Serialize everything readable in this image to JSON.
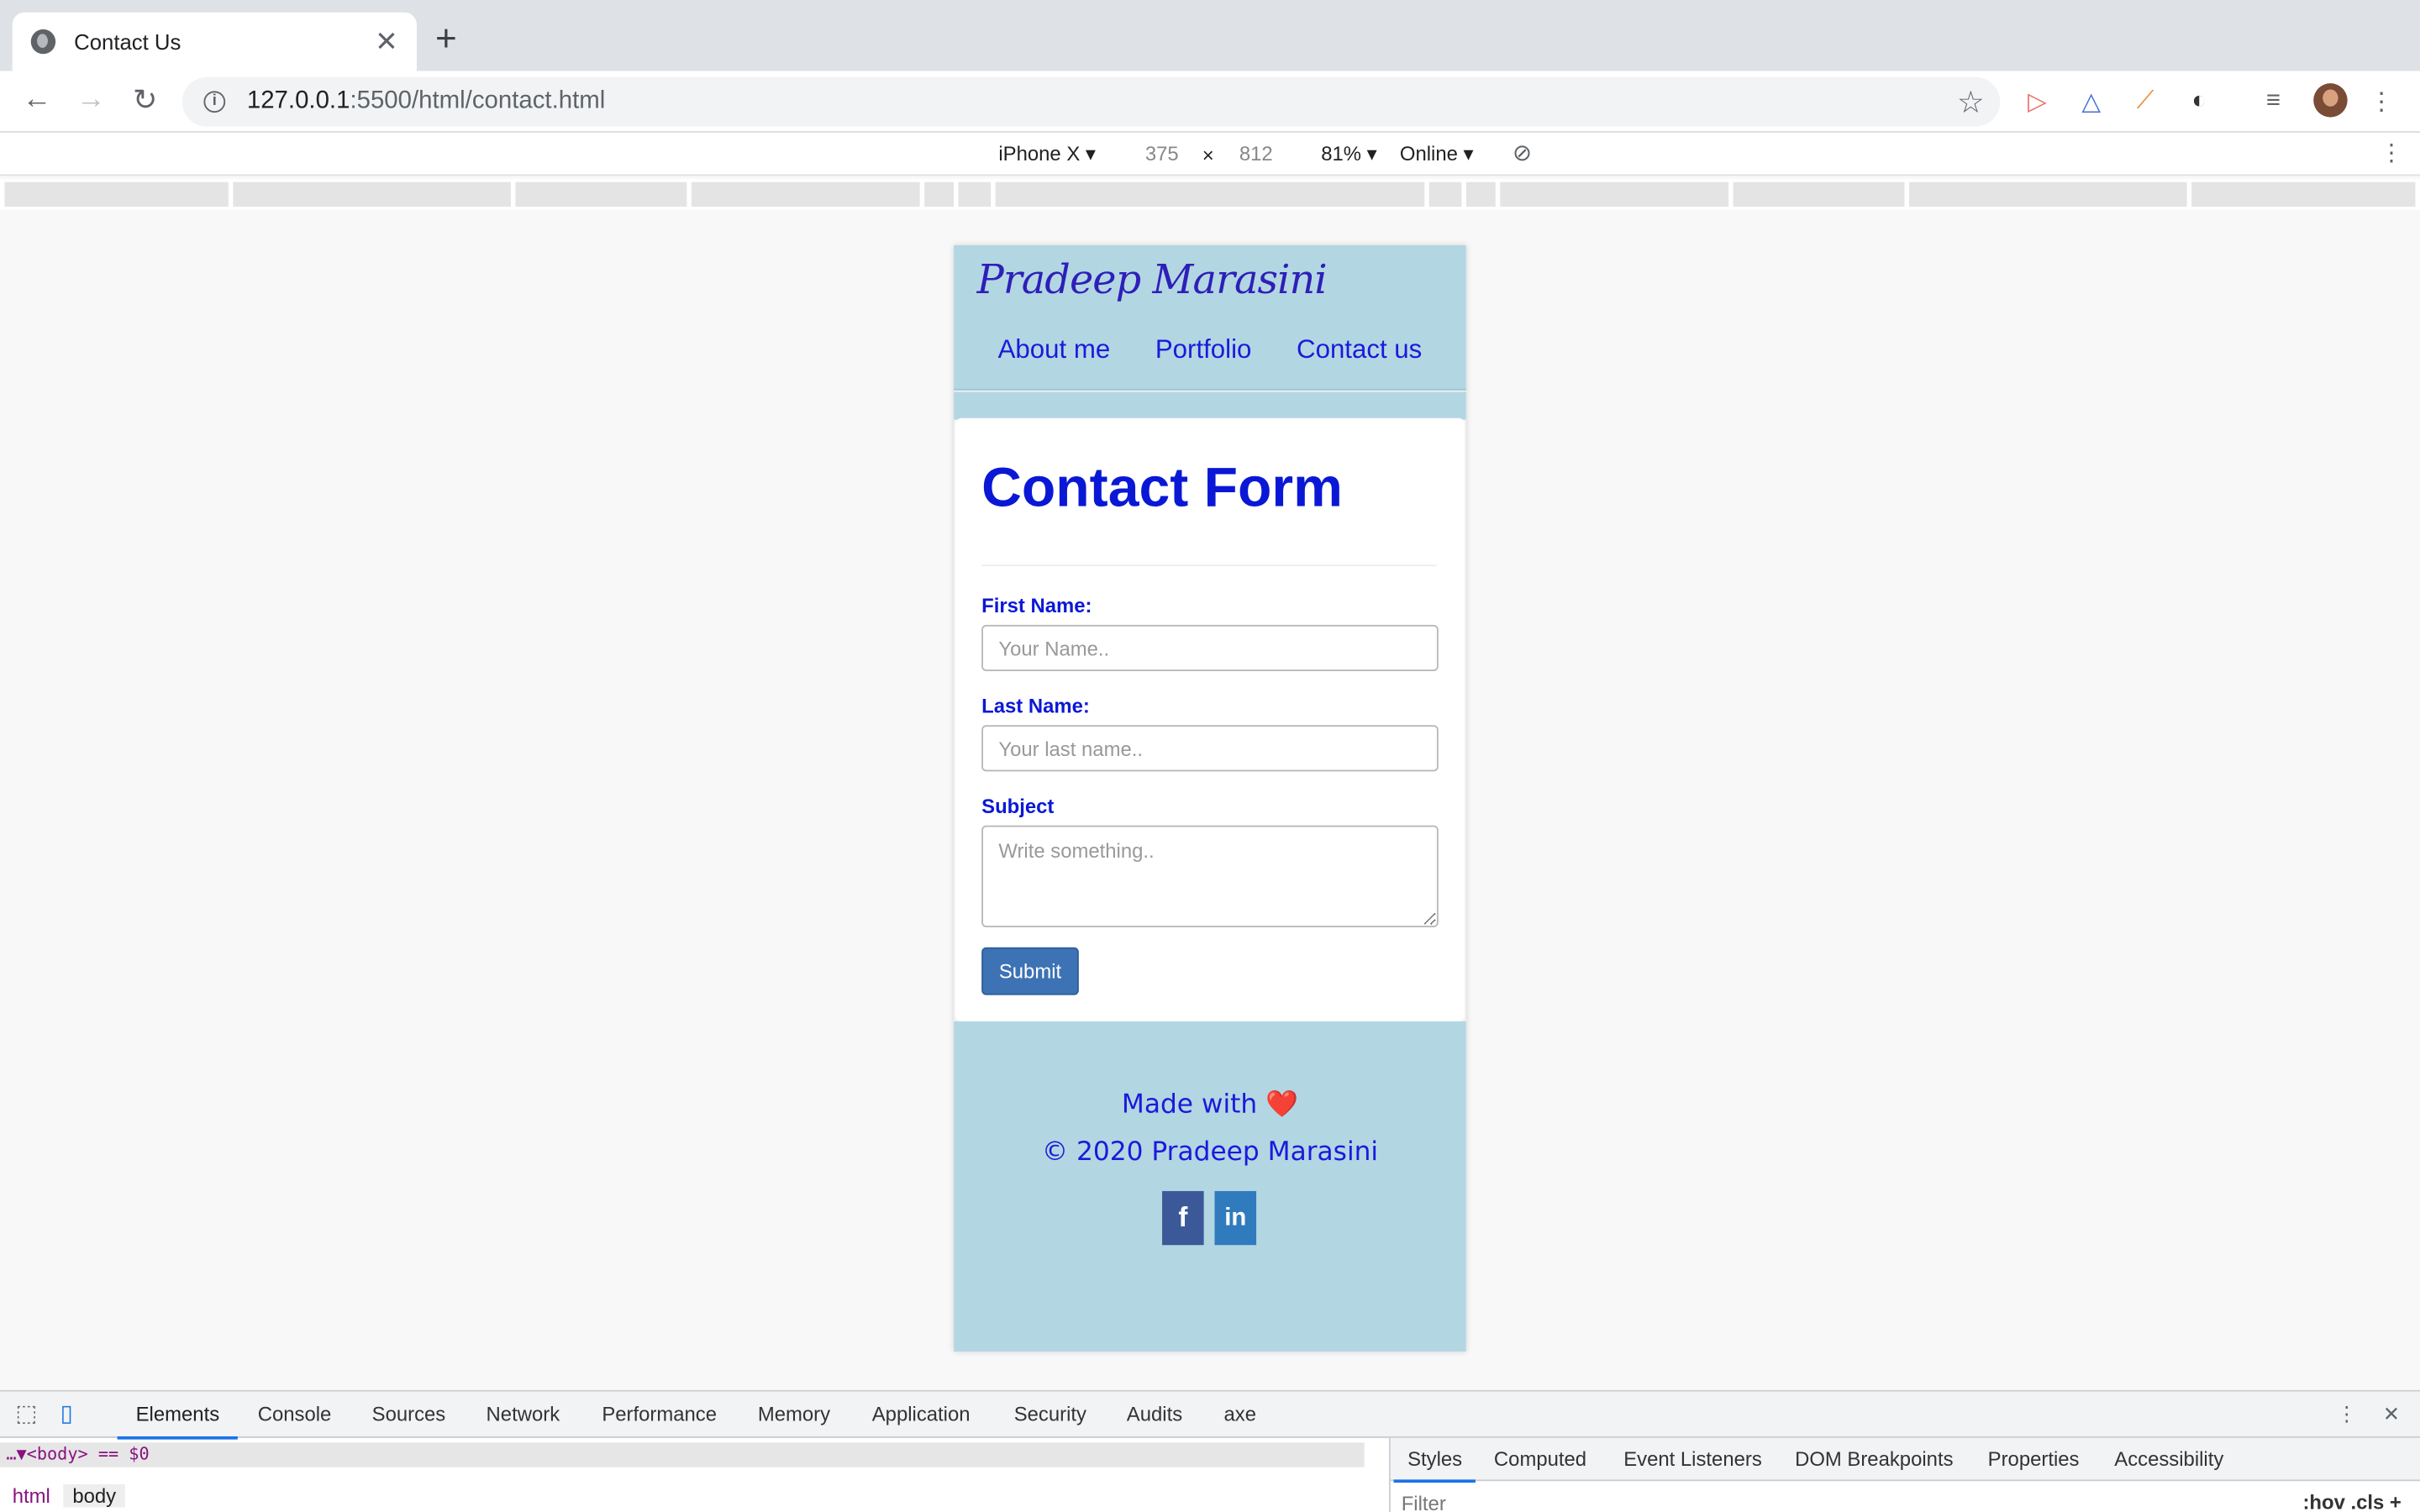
{
  "browser": {
    "tab_title": "Contact Us",
    "url_host": "127.0.0.1",
    "url_rest": ":5500/html/contact.html"
  },
  "device_toolbar": {
    "device": "iPhone X ▾",
    "width": "375",
    "times": "×",
    "height": "812",
    "zoom": "81% ▾",
    "network": "Online ▾"
  },
  "site": {
    "brand": "Pradeep Marasini",
    "nav": [
      "About me",
      "Portfolio",
      "Contact us"
    ],
    "form": {
      "title": "Contact Form",
      "first_name_label": "First Name:",
      "first_name_placeholder": "Your Name..",
      "last_name_label": "Last Name:",
      "last_name_placeholder": "Your last name..",
      "subject_label": "Subject",
      "subject_placeholder": "Write something..",
      "submit_label": "Submit"
    },
    "footer": {
      "made_with": "Made with",
      "heart": "❤️",
      "copyright": "© 2020 Pradeep Marasini",
      "facebook": "f",
      "linkedin": "in",
      "facebook_color": "#3b5998",
      "linkedin_color": "#2f7bbd"
    }
  },
  "devtools": {
    "tabs": [
      "Elements",
      "Console",
      "Sources",
      "Network",
      "Performance",
      "Memory",
      "Application",
      "Security",
      "Audits",
      "axe"
    ],
    "dom_line": "…▼<body> == $0",
    "breadcrumbs": [
      "html",
      "body"
    ],
    "styles_tabs": [
      "Styles",
      "Computed",
      "Event Listeners",
      "DOM Breakpoints",
      "Properties",
      "Accessibility"
    ],
    "filter_placeholder": "Filter",
    "filter_tools": ":hov  .cls  +"
  }
}
